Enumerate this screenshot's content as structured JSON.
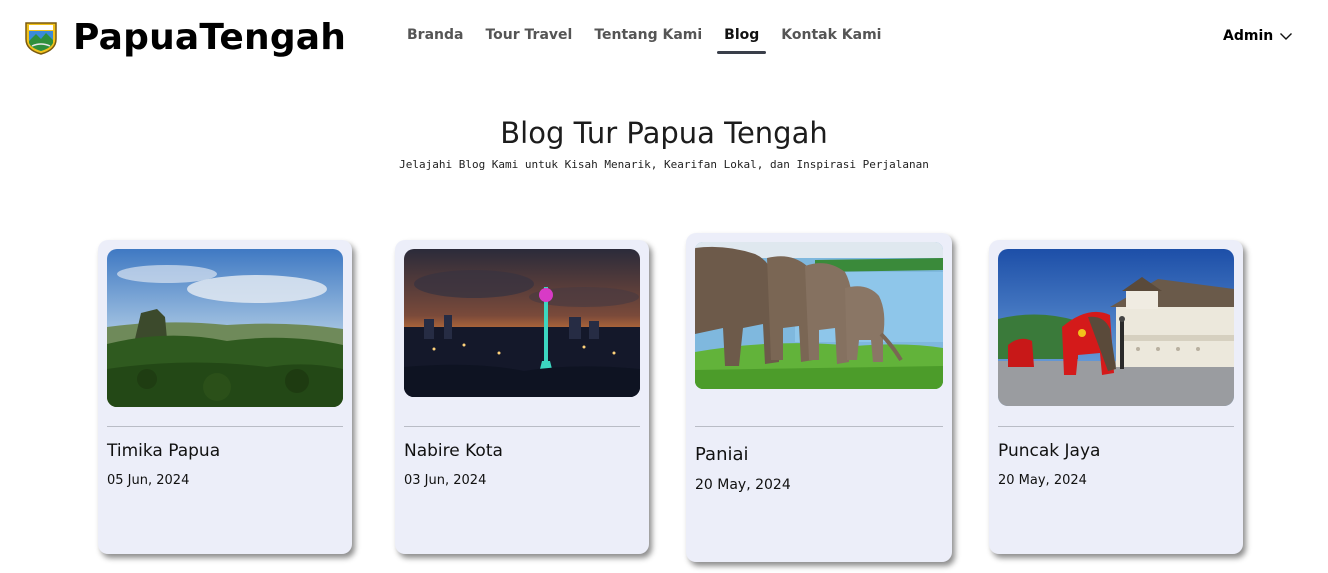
{
  "header": {
    "brand": "PapuaTengah",
    "nav": [
      {
        "label": "Branda"
      },
      {
        "label": "Tour Travel"
      },
      {
        "label": "Tentang Kami"
      },
      {
        "label": "Blog",
        "active": true
      },
      {
        "label": "Kontak Kami"
      }
    ],
    "user_menu": "Admin"
  },
  "hero": {
    "title": "Blog Tur Papua Tengah",
    "subtitle": "Jelajahi Blog Kami untuk Kisah Menarik, Kearifan Lokal, dan Inspirasi Perjalanan"
  },
  "posts": [
    {
      "title": "Timika Papua",
      "date": "05 Jun, 2024",
      "image": "mountain-forest-sunrise"
    },
    {
      "title": "Nabire Kota",
      "date": "03 Jun, 2024",
      "image": "city-night-tower"
    },
    {
      "title": "Paniai",
      "date": "20 May, 2024",
      "image": "elephants-grassland"
    },
    {
      "title": "Puncak Jaya",
      "date": "20 May, 2024",
      "image": "temple-festival-elephants"
    }
  ],
  "colors": {
    "card_bg": "#eceef9",
    "nav_active_underline": "#3a3f4a"
  }
}
